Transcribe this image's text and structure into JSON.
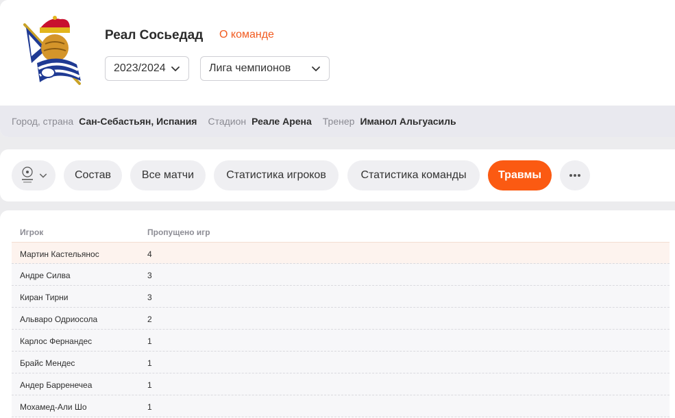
{
  "team": {
    "name": "Реал Сосьедад",
    "about_link": "О команде",
    "season": "2023/2024",
    "league": "Лига чемпионов"
  },
  "info": {
    "city_label": "Город, страна",
    "city_value": "Сан-Себастьян, Испания",
    "stadium_label": "Стадион",
    "stadium_value": "Реале Арена",
    "coach_label": "Тренер",
    "coach_value": "Иманол Альгуасиль"
  },
  "nav": {
    "tabs": [
      "Состав",
      "Все матчи",
      "Статистика игроков",
      "Статистика команды",
      "Травмы"
    ],
    "active_tab": "Травмы",
    "more": "•••"
  },
  "table": {
    "headers": {
      "player": "Игрок",
      "missed": "Пропущено игр"
    },
    "rows": [
      {
        "player": "Мартин Кастельянос",
        "missed": "4"
      },
      {
        "player": "Андре Силва",
        "missed": "3"
      },
      {
        "player": "Киран Тирни",
        "missed": "3"
      },
      {
        "player": "Альваро Одриосола",
        "missed": "2"
      },
      {
        "player": "Карлос Фернандес",
        "missed": "1"
      },
      {
        "player": "Брайс Мендес",
        "missed": "1"
      },
      {
        "player": "Андер Барренечеа",
        "missed": "1"
      },
      {
        "player": "Мохамед-Али Шо",
        "missed": "1"
      }
    ]
  },
  "colors": {
    "accent": "#fb5a12",
    "link": "#f15a1f",
    "highlight_row": "#fdf3ee"
  },
  "icons": {
    "logo": "real-sociedad-crest",
    "league": "champions-league-icon",
    "chevron": "chevron-down-icon"
  }
}
